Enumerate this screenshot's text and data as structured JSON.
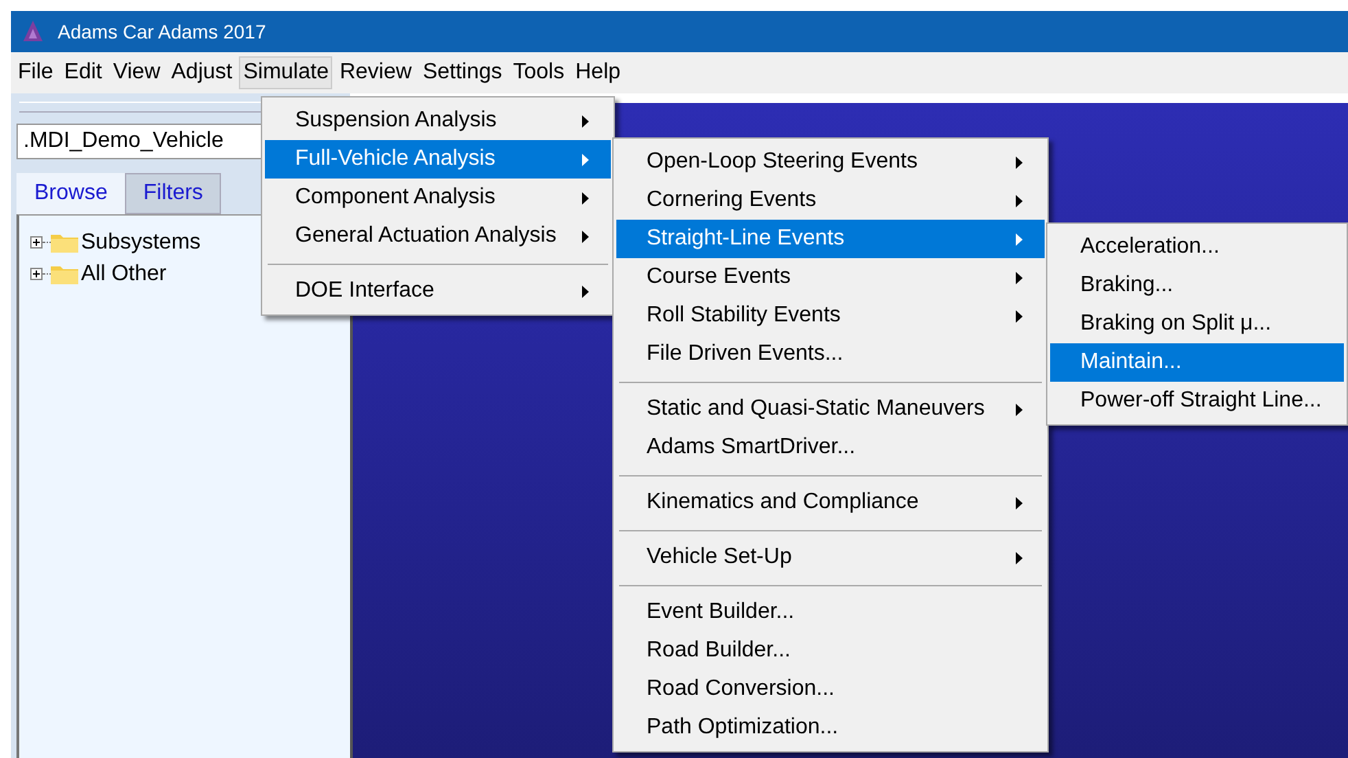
{
  "window": {
    "title": "Adams Car Adams 2017"
  },
  "menubar": [
    {
      "label": "File",
      "selected": false
    },
    {
      "label": "Edit",
      "selected": false
    },
    {
      "label": "View",
      "selected": false
    },
    {
      "label": "Adjust",
      "selected": false
    },
    {
      "label": "Simulate",
      "selected": true
    },
    {
      "label": "Review",
      "selected": false
    },
    {
      "label": "Settings",
      "selected": false
    },
    {
      "label": "Tools",
      "selected": false
    },
    {
      "label": "Help",
      "selected": false
    }
  ],
  "sidebar": {
    "model_field": {
      "value": ".MDI_Demo_Vehicle"
    },
    "tabs": [
      {
        "label": "Browse",
        "selected": true
      },
      {
        "label": "Filters",
        "selected": false
      }
    ],
    "tree": [
      {
        "label": "Subsystems",
        "expanded": false
      },
      {
        "label": "All Other",
        "expanded": false
      }
    ]
  },
  "menus": [
    {
      "items": [
        {
          "kind": "item",
          "label": "Suspension Analysis",
          "submenu": true,
          "selected": false
        },
        {
          "kind": "item",
          "label": "Full-Vehicle Analysis",
          "submenu": true,
          "selected": true
        },
        {
          "kind": "item",
          "label": "Component Analysis",
          "submenu": true,
          "selected": false
        },
        {
          "kind": "item",
          "label": "General Actuation Analysis",
          "submenu": true,
          "selected": false
        },
        {
          "kind": "separator"
        },
        {
          "kind": "item",
          "label": "DOE Interface",
          "submenu": true,
          "selected": false
        }
      ]
    },
    {
      "items": [
        {
          "kind": "item",
          "label": "Open-Loop Steering Events",
          "submenu": true,
          "selected": false
        },
        {
          "kind": "item",
          "label": "Cornering Events",
          "submenu": true,
          "selected": false
        },
        {
          "kind": "item",
          "label": "Straight-Line Events",
          "submenu": true,
          "selected": true
        },
        {
          "kind": "item",
          "label": "Course Events",
          "submenu": true,
          "selected": false
        },
        {
          "kind": "item",
          "label": "Roll Stability Events",
          "submenu": true,
          "selected": false
        },
        {
          "kind": "item",
          "label": "File Driven Events...",
          "submenu": false,
          "selected": false
        },
        {
          "kind": "separator"
        },
        {
          "kind": "item",
          "label": "Static and Quasi-Static Maneuvers",
          "submenu": true,
          "selected": false
        },
        {
          "kind": "item",
          "label": "Adams SmartDriver...",
          "submenu": false,
          "selected": false
        },
        {
          "kind": "separator"
        },
        {
          "kind": "item",
          "label": "Kinematics and Compliance",
          "submenu": true,
          "selected": false
        },
        {
          "kind": "separator"
        },
        {
          "kind": "item",
          "label": "Vehicle Set-Up",
          "submenu": true,
          "selected": false
        },
        {
          "kind": "separator"
        },
        {
          "kind": "item",
          "label": "Event Builder...",
          "submenu": false,
          "selected": false
        },
        {
          "kind": "item",
          "label": "Road Builder...",
          "submenu": false,
          "selected": false
        },
        {
          "kind": "item",
          "label": "Road Conversion...",
          "submenu": false,
          "selected": false
        },
        {
          "kind": "item",
          "label": "Path Optimization...",
          "submenu": false,
          "selected": false
        }
      ]
    },
    {
      "items": [
        {
          "kind": "item",
          "label": "Acceleration...",
          "submenu": false,
          "selected": false
        },
        {
          "kind": "item",
          "label": "Braking...",
          "submenu": false,
          "selected": false
        },
        {
          "kind": "item",
          "label": "Braking on Split μ...",
          "submenu": false,
          "selected": false
        },
        {
          "kind": "item",
          "label": "Maintain...",
          "submenu": false,
          "selected": true
        },
        {
          "kind": "item",
          "label": "Power-off Straight Line...",
          "submenu": false,
          "selected": false
        }
      ]
    }
  ]
}
